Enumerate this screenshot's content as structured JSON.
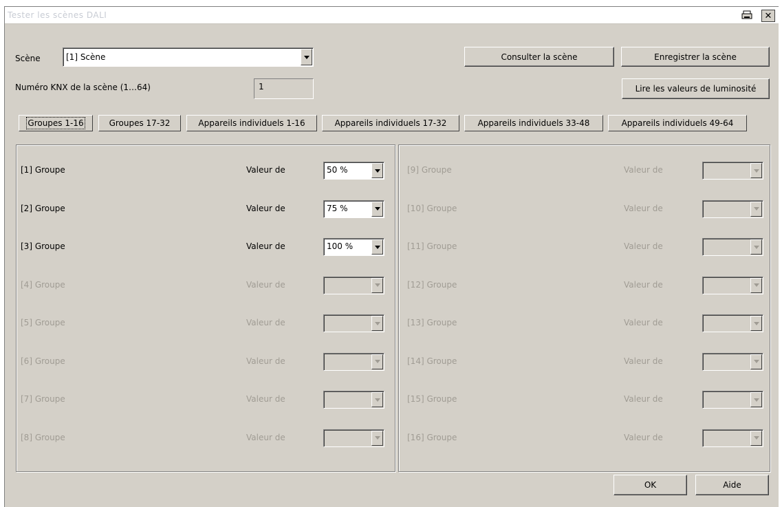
{
  "window": {
    "title": "Tester les scènes DALI"
  },
  "scene": {
    "label": "Scène",
    "value": "[1] Scène"
  },
  "knx": {
    "label": "Numéro KNX de la scène (1…64)",
    "value": "1"
  },
  "buttons": {
    "consult": "Consulter la scène",
    "save": "Enregistrer la scène",
    "read": "Lire les valeurs de luminosité",
    "ok": "OK",
    "help": "Aide"
  },
  "tabs": [
    "Groupes 1-16",
    "Groupes 17-32",
    "Appareils individuels 1-16",
    "Appareils individuels 17-32",
    "Appareils individuels 33-48",
    "Appareils individuels 49-64"
  ],
  "value_label": "Valeur de",
  "groups_left": [
    {
      "name": "[1] Groupe",
      "value": "50 %",
      "enabled": true
    },
    {
      "name": "[2] Groupe",
      "value": "75 %",
      "enabled": true
    },
    {
      "name": "[3] Groupe",
      "value": "100 %",
      "enabled": true
    },
    {
      "name": "[4] Groupe",
      "value": "",
      "enabled": false
    },
    {
      "name": "[5] Groupe",
      "value": "",
      "enabled": false
    },
    {
      "name": "[6] Groupe",
      "value": "",
      "enabled": false
    },
    {
      "name": "[7] Groupe",
      "value": "",
      "enabled": false
    },
    {
      "name": "[8] Groupe",
      "value": "",
      "enabled": false
    }
  ],
  "groups_right": [
    {
      "name": "[9] Groupe",
      "value": "",
      "enabled": false
    },
    {
      "name": "[10] Groupe",
      "value": "",
      "enabled": false
    },
    {
      "name": "[11] Groupe",
      "value": "",
      "enabled": false
    },
    {
      "name": "[12] Groupe",
      "value": "",
      "enabled": false
    },
    {
      "name": "[13] Groupe",
      "value": "",
      "enabled": false
    },
    {
      "name": "[14] Groupe",
      "value": "",
      "enabled": false
    },
    {
      "name": "[15] Groupe",
      "value": "",
      "enabled": false
    },
    {
      "name": "[16] Groupe",
      "value": "",
      "enabled": false
    }
  ],
  "icons": {
    "print": "print-icon",
    "close": "close-icon",
    "dropdown": "chevron-down-icon"
  }
}
